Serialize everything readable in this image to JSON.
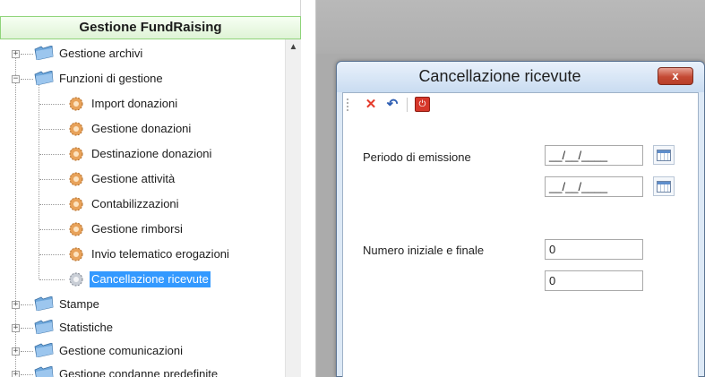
{
  "nav": {
    "header": "Gestione FundRaising",
    "items": [
      {
        "label": "Gestione archivi",
        "type": "folder",
        "expander": "+"
      },
      {
        "label": "Funzioni di gestione",
        "type": "folder",
        "expander": "−"
      },
      {
        "label": "Import donazioni",
        "type": "gear"
      },
      {
        "label": "Gestione donazioni",
        "type": "gear"
      },
      {
        "label": "Destinazione donazioni",
        "type": "gear"
      },
      {
        "label": "Gestione attività",
        "type": "gear"
      },
      {
        "label": "Contabilizzazioni",
        "type": "gear"
      },
      {
        "label": "Gestione rimborsi",
        "type": "gear"
      },
      {
        "label": "Invio telematico erogazioni",
        "type": "gear"
      },
      {
        "label": "Cancellazione ricevute",
        "type": "gear",
        "selected": true
      },
      {
        "label": "Stampe",
        "type": "folder",
        "expander": "+"
      },
      {
        "label": "Statistiche",
        "type": "folder",
        "expander": "+"
      },
      {
        "label": "Gestione comunicazioni",
        "type": "folder",
        "expander": "+"
      },
      {
        "label": "Gestione condanne predefinite",
        "type": "folder",
        "expander": "+"
      }
    ]
  },
  "dialog": {
    "title": "Cancellazione ricevute",
    "close_label": "x",
    "toolbar": {
      "cancel_icon": "✕",
      "undo_icon": "↶",
      "exit_icon": "⏻"
    },
    "periodo_label": "Periodo di emissione",
    "date_from": "__/__/____",
    "date_to": "__/__/____",
    "numero_label": "Numero iniziale e finale",
    "num_from": "0",
    "num_to": "0"
  },
  "colors": {
    "selected_bg": "#3399ff",
    "header_border": "#8fd47a",
    "close_red": "#c44a34"
  }
}
